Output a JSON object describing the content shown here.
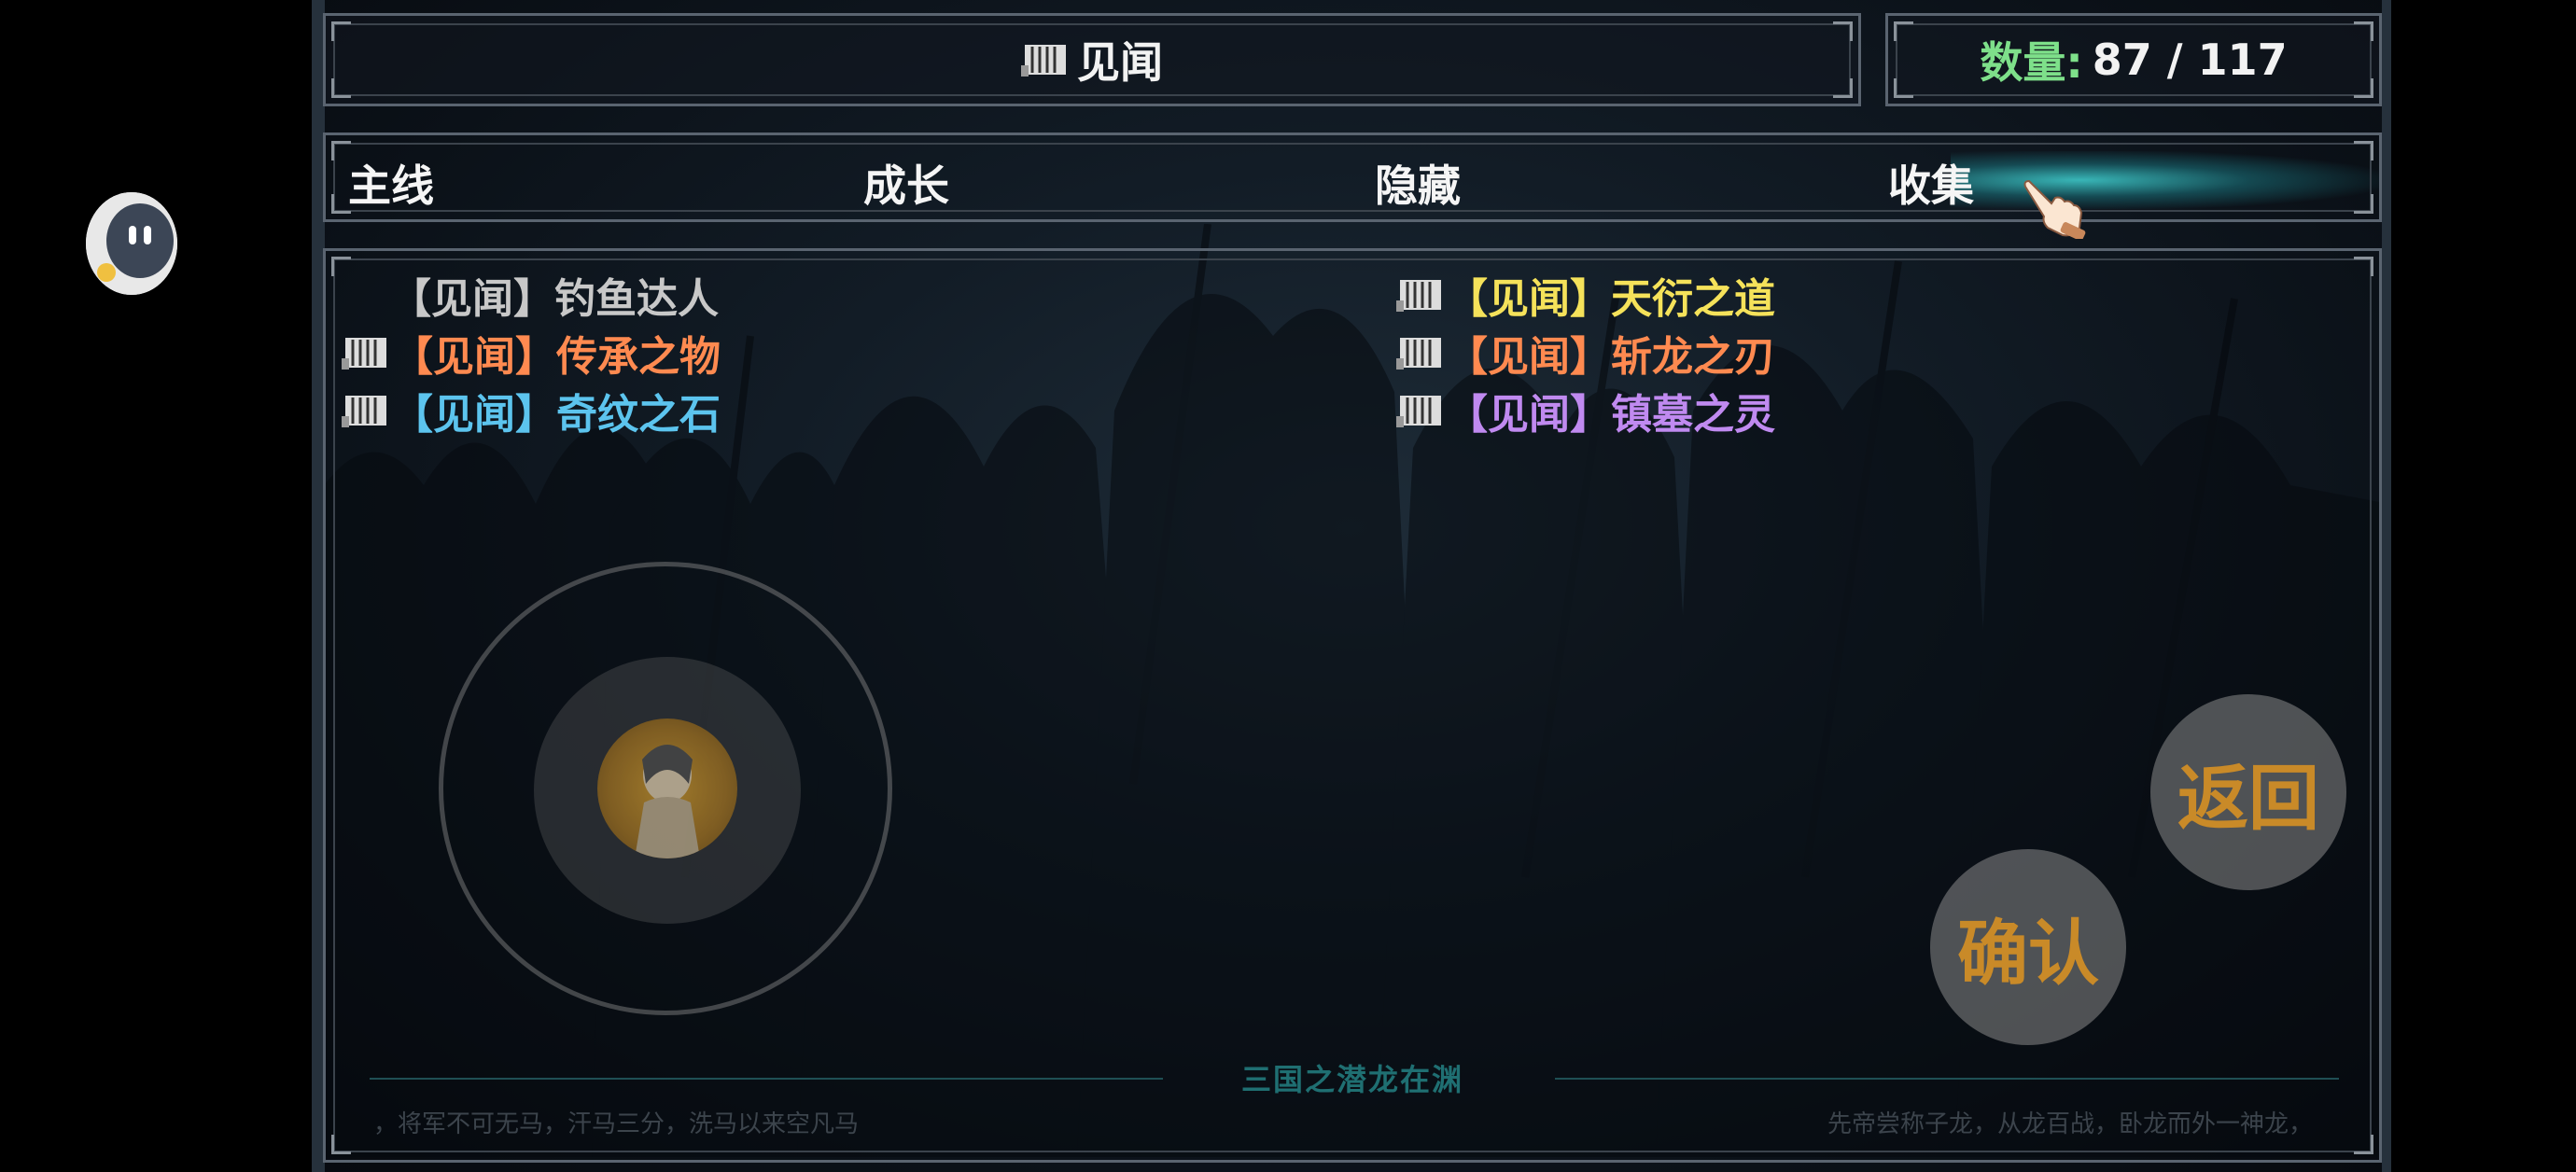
{
  "header": {
    "title": "见闻",
    "count_label": "数量:",
    "count_value": "87 / 117"
  },
  "tabs": [
    {
      "label": "主线",
      "active": false
    },
    {
      "label": "成长",
      "active": false
    },
    {
      "label": "隐藏",
      "active": false
    },
    {
      "label": "收集",
      "active": true
    }
  ],
  "entries": [
    {
      "tag": "【见闻】",
      "name": "钓鱼达人",
      "color": "#c8c8c8",
      "has_icon": false
    },
    {
      "tag": "【见闻】",
      "name": "传承之物",
      "color": "#ff8a50",
      "has_icon": true
    },
    {
      "tag": "【见闻】",
      "name": "奇纹之石",
      "color": "#5cc4ee",
      "has_icon": true
    },
    {
      "tag": "【见闻】",
      "name": "天衍之道",
      "color": "#f5e25a",
      "has_icon": true
    },
    {
      "tag": "【见闻】",
      "name": "斩龙之刃",
      "color": "#ff8a50",
      "has_icon": true
    },
    {
      "tag": "【见闻】",
      "name": "镇墓之灵",
      "color": "#c08af0",
      "has_icon": true
    }
  ],
  "buttons": {
    "back": "返回",
    "confirm": "确认"
  },
  "footer": {
    "title": "三国之潜龙在渊",
    "left_quote": "，将军不可无马，汗马三分，洗马以来空凡马",
    "right_quote": "先帝尝称子龙，从龙百战，卧龙而外一神龙，"
  },
  "icons": [
    "book-icon",
    "pointing-hand-icon",
    "floating-assistant-icon"
  ]
}
